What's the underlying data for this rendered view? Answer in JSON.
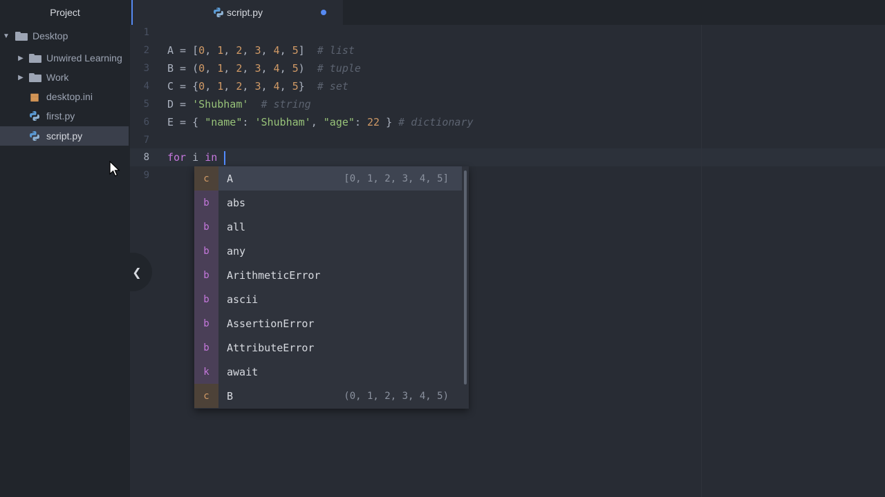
{
  "sidebar": {
    "title": "Project",
    "items": [
      {
        "label": "Desktop",
        "type": "folder",
        "expanded": true,
        "depth": 0
      },
      {
        "label": "Unwired Learning",
        "type": "folder",
        "expanded": false,
        "depth": 1
      },
      {
        "label": "Work",
        "type": "folder",
        "expanded": false,
        "depth": 1
      },
      {
        "label": "desktop.ini",
        "type": "ini-file",
        "depth": 1
      },
      {
        "label": "first.py",
        "type": "python-file",
        "depth": 1
      },
      {
        "label": "script.py",
        "type": "python-file",
        "depth": 1,
        "selected": true
      }
    ]
  },
  "tabs": [
    {
      "label": "script.py",
      "modified": true,
      "active": true
    }
  ],
  "editor": {
    "line_numbers": [
      "1",
      "2",
      "3",
      "4",
      "5",
      "6",
      "7",
      "8",
      "9"
    ],
    "active_line": "8",
    "lines": {
      "l2": {
        "a": "A = [",
        "b": "0",
        "c": ", ",
        "d": "1",
        "e": ", ",
        "f": "2",
        "g": ", ",
        "h": "3",
        "i": ", ",
        "j": "4",
        "k": ", ",
        "l": "5",
        "m": "]  ",
        "n": "# list"
      },
      "l3": {
        "a": "B = (",
        "b": "0",
        "c": ", ",
        "d": "1",
        "e": ", ",
        "f": "2",
        "g": ", ",
        "h": "3",
        "i": ", ",
        "j": "4",
        "k": ", ",
        "l": "5",
        "m": ")  ",
        "n": "# tuple"
      },
      "l4": {
        "a": "C = {",
        "b": "0",
        "c": ", ",
        "d": "1",
        "e": ", ",
        "f": "2",
        "g": ", ",
        "h": "3",
        "i": ", ",
        "j": "4",
        "k": ", ",
        "l": "5",
        "m": "}  ",
        "n": "# set"
      },
      "l5": {
        "a": "D = ",
        "s": "'Shubham'",
        "m": "  ",
        "n": "# string"
      },
      "l6": {
        "a": "E = { ",
        "s1": "\"name\"",
        "b": ": ",
        "s2": "'Shubham'",
        "c": ", ",
        "s3": "\"age\"",
        "d": ": ",
        "n1": "22",
        "e": " } ",
        "n": "# dictionary"
      },
      "l8": {
        "kw1": "for",
        "a": " i ",
        "kw2": "in",
        "b": " "
      }
    }
  },
  "autocomplete": {
    "items": [
      {
        "type": "c",
        "text": "A",
        "right": "[0, 1, 2, 3, 4, 5]",
        "selected": true
      },
      {
        "type": "b",
        "text": "abs",
        "right": ""
      },
      {
        "type": "b",
        "text": "all",
        "right": ""
      },
      {
        "type": "b",
        "text": "any",
        "right": ""
      },
      {
        "type": "b",
        "text": "ArithmeticError",
        "right": ""
      },
      {
        "type": "b",
        "text": "ascii",
        "right": ""
      },
      {
        "type": "b",
        "text": "AssertionError",
        "right": ""
      },
      {
        "type": "b",
        "text": "AttributeError",
        "right": ""
      },
      {
        "type": "k",
        "text": "await",
        "right": ""
      },
      {
        "type": "c",
        "text": "B",
        "right": "(0, 1, 2, 3, 4, 5)"
      }
    ]
  },
  "icons": {
    "collapse": "chevron-left-icon",
    "folder": "folder-icon",
    "python": "python-icon",
    "ini": "settings-file-icon",
    "expanded": "chevron-down-icon",
    "collapsed": "chevron-right-icon",
    "pointer": "mouse-pointer-icon"
  },
  "colors": {
    "accent": "#568af2",
    "string": "#98c379",
    "number": "#d19a66",
    "keyword": "#c678dd",
    "comment": "#5c6370"
  }
}
